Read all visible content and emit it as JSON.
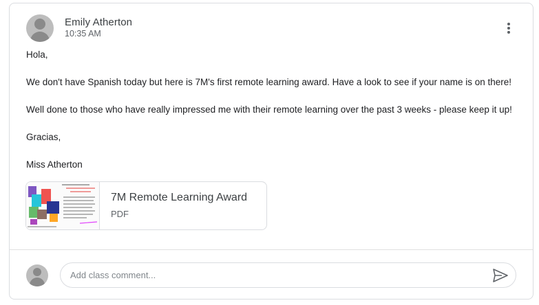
{
  "post": {
    "author": "Emily Atherton",
    "time": "10:35 AM",
    "paragraphs": [
      "Hola,",
      "We don't have Spanish today but here is 7M's first remote learning award. Have a look to see if your name is on there!",
      "Well done to those who have really impressed me with their remote learning over the past 3 weeks - please keep it up!",
      "Gracias,",
      "Miss Atherton"
    ],
    "attachment": {
      "title": "7M Remote Learning Award",
      "type": "PDF"
    }
  },
  "comment_box": {
    "placeholder": "Add class comment..."
  },
  "icons": {
    "more": "more-vert-icon",
    "send": "send-icon",
    "avatar": "person-icon"
  },
  "colors": {
    "border": "#dadce0",
    "secondary_text": "#5f6368",
    "avatar_bg": "#bdbdbd"
  }
}
